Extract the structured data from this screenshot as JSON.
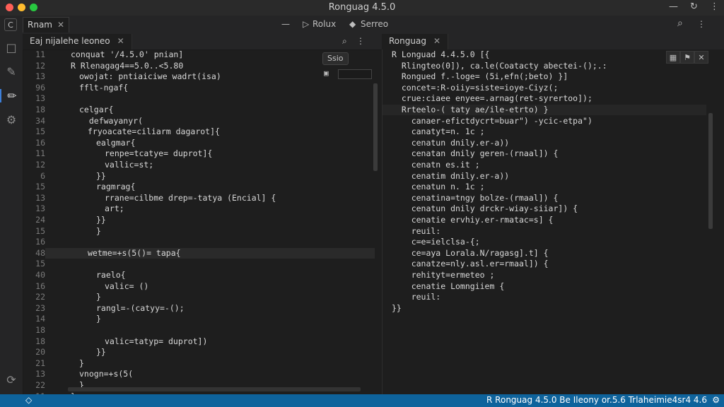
{
  "window": {
    "title": "Ronguag 4.5.0"
  },
  "titlebar_icons": {
    "minimize": "—",
    "refresh": "↻",
    "more": "⋮"
  },
  "toolbar": {
    "tab_label": "Rnam",
    "tab_close": "✕",
    "items": [
      {
        "icon": "—",
        "label": ""
      },
      {
        "icon": "▷",
        "label": "Rolux"
      },
      {
        "icon": "◆",
        "label": "Serreo"
      }
    ],
    "search_icon": "⌕",
    "more_icon": "⋮"
  },
  "left_pane": {
    "tab_label": "Eaj nijalehe leoneo",
    "tab_close": "✕",
    "icons": [
      "⌕",
      "⋮"
    ],
    "mini_button": "Ssio",
    "gutter": [
      "11",
      "12",
      "13",
      "96",
      "13",
      "18",
      "34",
      "15",
      "16",
      "11",
      "12",
      "6",
      "15",
      "13",
      "13",
      "24",
      "15",
      "16",
      "48",
      "15",
      "40",
      "16",
      "22",
      "23",
      "14",
      "18",
      "18",
      "20",
      "21",
      "13",
      "22",
      "11"
    ],
    "lines": [
      {
        "n": "11",
        "indent": 0,
        "text": "conquat '/4.5.0' pnian]"
      },
      {
        "n": "12",
        "indent": 0,
        "text": "R Rlenagag4==5.0..<5.80"
      },
      {
        "n": "13",
        "indent": 1,
        "text": "owojat: pntiaiciwe wadrt(isa)"
      },
      {
        "n": "96",
        "indent": 1,
        "text": "fflt-ngaf{"
      },
      {
        "n": "13",
        "indent": 0,
        "text": ""
      },
      {
        "n": "18",
        "indent": 1,
        "text": "celgar{"
      },
      {
        "n": "34",
        "indent": 1,
        "text": "  defwayanyr("
      },
      {
        "n": "15",
        "indent": 2,
        "text": "fryoacate=ciliarm dagarot]{"
      },
      {
        "n": "16",
        "indent": 3,
        "text": "ealgmar{"
      },
      {
        "n": "11",
        "indent": 4,
        "text": "renpe=tcatye= duprot]{"
      },
      {
        "n": "12",
        "indent": 4,
        "text": "vallic=st;"
      },
      {
        "n": "6",
        "indent": 3,
        "text": "}}"
      },
      {
        "n": "15",
        "indent": 3,
        "text": "ragmrag{"
      },
      {
        "n": "13",
        "indent": 4,
        "text": "rrane=cilbme drep=-tatya (Encial] {"
      },
      {
        "n": "13",
        "indent": 4,
        "text": "art;"
      },
      {
        "n": "24",
        "indent": 3,
        "text": "}}"
      },
      {
        "n": "15",
        "indent": 3,
        "text": "}"
      },
      {
        "n": "16",
        "indent": 0,
        "text": ""
      },
      {
        "n": "48",
        "indent": 2,
        "text": "wetme=+s(5()= tapa{"
      },
      {
        "n": "15",
        "indent": 0,
        "text": ""
      },
      {
        "n": "40",
        "indent": 3,
        "text": "raelo{"
      },
      {
        "n": "16",
        "indent": 4,
        "text": "valic= ()"
      },
      {
        "n": "22",
        "indent": 3,
        "text": "}"
      },
      {
        "n": "23",
        "indent": 3,
        "text": "rangl=-(catyy=-();"
      },
      {
        "n": "14",
        "indent": 3,
        "text": "}"
      },
      {
        "n": "18",
        "indent": 0,
        "text": ""
      },
      {
        "n": "18",
        "indent": 4,
        "text": "valic=tatyp= duprot])"
      },
      {
        "n": "20",
        "indent": 3,
        "text": "}}"
      },
      {
        "n": "21",
        "indent": 1,
        "text": "}"
      },
      {
        "n": "13",
        "indent": 1,
        "text": "vnogn=+s(5("
      },
      {
        "n": "22",
        "indent": 1,
        "text": "}"
      },
      {
        "n": "11",
        "indent": 0,
        "text": "}"
      }
    ]
  },
  "right_pane": {
    "tab_label": "Ronguag",
    "tab_close": "✕",
    "buttons": [
      "▦",
      "⚑",
      "✕"
    ],
    "lines": [
      "R Longuad 4.4.5.0 [{",
      "  Rlingteo(0]), ca.le(Coatacty abectei-();.:",
      "  Rongued f.-loge= (5i,efn(;beto) }]",
      "  concet=:R-oiiy=siste=ioye-Ciyz(;",
      "  crue:ciaee enyee=.arnag(ret-syrertoo]);",
      "  Rrteelo-( taty ae/ile-etrto) }",
      "    canaer-efictdycrt=buar\") -ycic-etpa\")",
      "    canatyt=n. 1c ;",
      "    cenatun dnily.er-a))",
      "    cenatan dnily geren-(rnaal]) {",
      "    cenatn es.it ;",
      "    cenatim dnily.er-a))",
      "    cenatun n. 1c ;",
      "    cenatina=tngy bolze-(rmaal]) {",
      "    cenatun dnily drckr-wiay-siiar]) {",
      "    cenatie ervhiy.er-rmatac=s] {",
      "    reuil:",
      "    c=e=ielclsa-{;",
      "    ce=aya Lorala.N/ragasg].t] {",
      "    canatze=nly.asl.er=rmaal]) {",
      "    rehityt=ermeteo ;",
      "    cenatie Lomngiiem {",
      "    reuil:",
      "}}"
    ]
  },
  "activity_icons": [
    "□",
    "✎",
    "✏",
    "⚙",
    "⟳"
  ],
  "statusbar": {
    "left_icon": "◇",
    "text": "R Ronguag 4.5.0  Be Ileony or.5.6 Trlaheimie4sr4 4.6",
    "gear": "⚙"
  }
}
